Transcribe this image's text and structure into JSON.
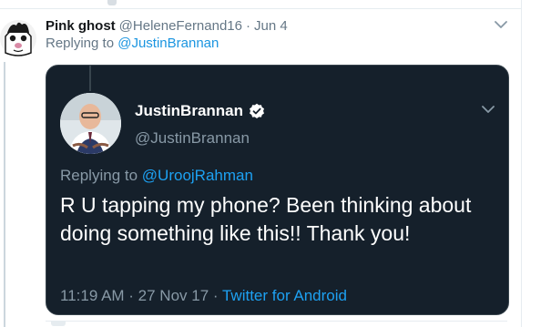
{
  "reply": {
    "display_name": "Pink ghost",
    "handle": "@HeleneFernand16",
    "separator": "·",
    "time": "Jun 4",
    "replying_prefix": "Replying to",
    "replying_mention": "@JustinBrannan"
  },
  "quoted": {
    "display_name": "JustinBrannan",
    "handle": "@JustinBrannan",
    "replying_prefix": "Replying to",
    "replying_mention": "@UroojRahman",
    "text": "R U tapping my phone? Been thinking about doing something like this!! Thank you!",
    "timestamp": "11:19 AM · 27 Nov 17 ·",
    "source": "Twitter for Android"
  },
  "icons": {
    "outer_menu": "chevron-down-icon",
    "quoted_menu": "chevron-down-icon",
    "verified": "verified-badge-icon"
  },
  "colors": {
    "link": "#1b95e0",
    "dark_card_bg": "#15202b",
    "verified": "#ffffff"
  }
}
